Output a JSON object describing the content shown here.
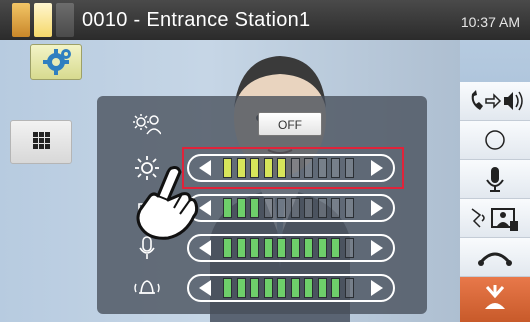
{
  "header": {
    "title": "0010 - Entrance Station1",
    "clock": "10:37 AM"
  },
  "colors": {
    "titlebar": "#2b2b2b",
    "status_yellow": "#f5d86a",
    "status_orange": "#c9872a",
    "highlight": "#e0233a",
    "tick_active": "#d7e55a",
    "tick_green": "#6ecf6a",
    "end_call": "#c85a2a"
  },
  "controls": {
    "off_toggle_label": "OFF",
    "rows": [
      {
        "name": "backlight",
        "icon": "sun-person-icon"
      },
      {
        "name": "brightness",
        "icon": "brightness-icon",
        "level": 0.5
      },
      {
        "name": "speaker-volume",
        "icon": "speaker-icon",
        "level": 0.3
      },
      {
        "name": "microphone-volume",
        "icon": "microphone-icon",
        "level": 0.9
      },
      {
        "name": "ringtone-volume",
        "icon": "bell-icon",
        "level": 0.9
      }
    ]
  },
  "sidebar": {
    "left_buttons": [
      "settings-icon",
      "grid-icon"
    ],
    "right_buttons": [
      "call-transfer-icon",
      "record-icon",
      "mic-icon",
      "monitor-icon",
      "hangup-icon",
      "end-icon"
    ]
  }
}
